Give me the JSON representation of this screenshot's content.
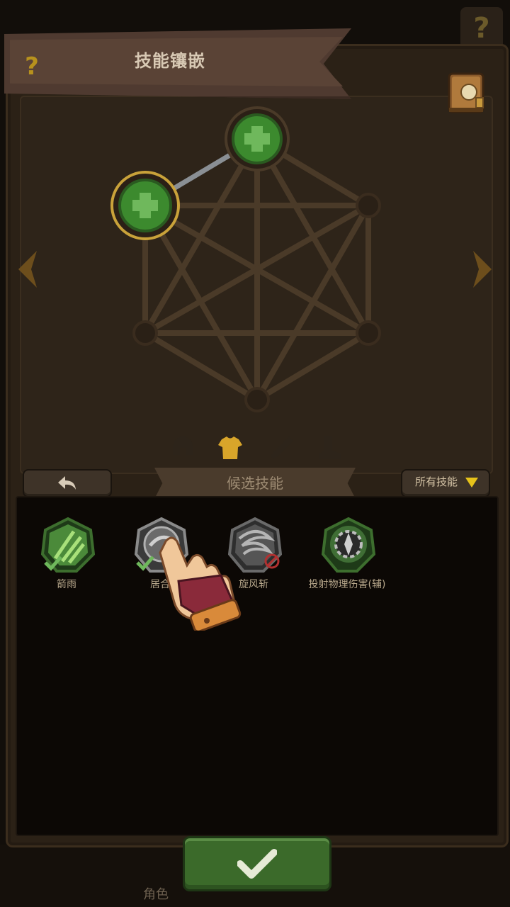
{
  "header": {
    "title": "技能镶嵌",
    "help_icon": "?"
  },
  "background": {
    "help_icon": "?"
  },
  "controls": {
    "candidate_label": "候选技能",
    "filter_label": "所有技能"
  },
  "gear_tabs": [
    {
      "name": "helmet",
      "active": false
    },
    {
      "name": "armor",
      "active": true
    },
    {
      "name": "weapon",
      "active": false
    },
    {
      "name": "boots",
      "active": false
    }
  ],
  "skills": [
    {
      "name": "箭雨",
      "equipped": true,
      "locked": false,
      "color": "#4b8a3a"
    },
    {
      "name": "居合",
      "equipped": true,
      "locked": false,
      "color": "#7a7a7a"
    },
    {
      "name": "旋风斩",
      "equipped": false,
      "locked": true,
      "color": "#6a6a6a"
    },
    {
      "name": "投射物理伤害(辅)",
      "equipped": false,
      "locked": false,
      "color": "#3f6e35"
    }
  ],
  "bottom_nav": {
    "character_label": "角色"
  },
  "colors": {
    "accent_green": "#3b6a2a",
    "gold": "#b8921d",
    "panel": "#2b2116"
  }
}
